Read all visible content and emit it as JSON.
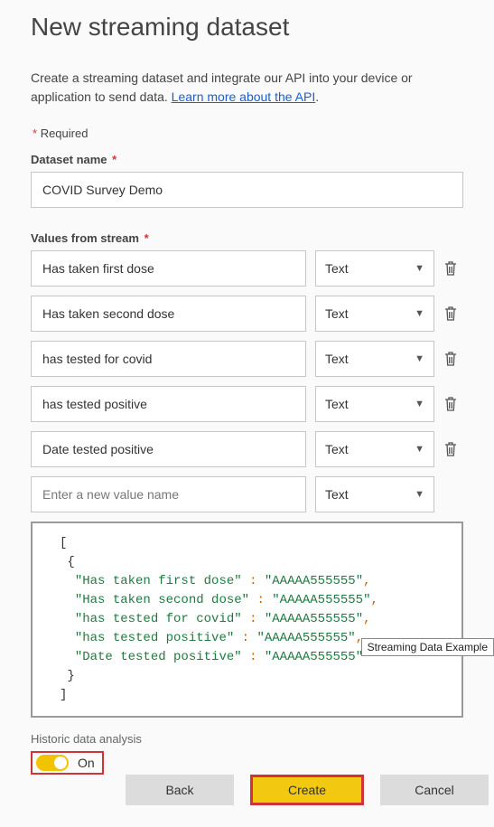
{
  "title": "New streaming dataset",
  "intro_text": "Create a streaming dataset and integrate our API into your device or application to send data. ",
  "intro_link": "Learn more about the API",
  "required_label": "Required",
  "dataset_name_label": "Dataset name",
  "dataset_name_value": "COVID Survey Demo",
  "values_label": "Values from stream",
  "stream_rows": [
    {
      "name": "Has taken first dose",
      "type": "Text",
      "deletable": true
    },
    {
      "name": "Has taken second dose",
      "type": "Text",
      "deletable": true
    },
    {
      "name": "has tested for covid",
      "type": "Text",
      "deletable": true
    },
    {
      "name": "has tested positive",
      "type": "Text",
      "deletable": true
    },
    {
      "name": "Date tested positive",
      "type": "Text",
      "deletable": true
    },
    {
      "name": "",
      "placeholder": "Enter a new value name",
      "type": "Text",
      "deletable": false
    }
  ],
  "json_preview": {
    "fields": [
      {
        "key": "Has taken first dose",
        "value": "AAAAA555555"
      },
      {
        "key": "Has taken second dose",
        "value": "AAAAA555555"
      },
      {
        "key": "has tested for covid",
        "value": "AAAAA555555"
      },
      {
        "key": "has tested positive",
        "value": "AAAAA555555"
      },
      {
        "key": "Date tested positive",
        "value": "AAAAA555555"
      }
    ]
  },
  "historic_label": "Historic data analysis",
  "toggle_state": "On",
  "buttons": {
    "back": "Back",
    "create": "Create",
    "cancel": "Cancel"
  },
  "tooltip": "Streaming Data Example"
}
